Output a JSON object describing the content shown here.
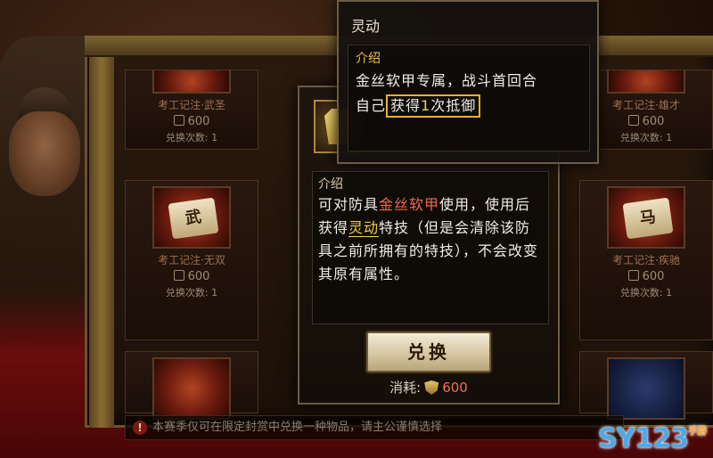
{
  "skill_tooltip": {
    "title": "灵动",
    "section_label": "介绍",
    "line1": "金丝软甲专属，战斗首回合",
    "line2_prefix": "自己",
    "line2_boxed_a": "获得",
    "line2_boxed_num": "1",
    "line2_boxed_b": "次抵御"
  },
  "item_popup": {
    "section_label": "介绍",
    "text_1": "可对防具",
    "armor_name": "金丝软甲",
    "text_2": "使用，使用后获得",
    "skill_name": "灵动",
    "text_3": "特技（但是会清除该防具之前所拥有的特技），不会改变其原有属性。",
    "exchange_button": "兑换",
    "cost_label": "消耗:",
    "cost_amount": "600"
  },
  "shop_cells": [
    {
      "name": "考工记注·武圣",
      "price": "600",
      "times": "兑换次数: 1"
    },
    {
      "name": "考工记注·雄才",
      "price": "600",
      "times": "兑换次数: 1"
    },
    {
      "name": "考工记注·无双",
      "price": "600",
      "times": "兑换次数: 1",
      "glyph": "武"
    },
    {
      "name": "考工记注·疾驰",
      "price": "600",
      "times": "兑换次数: 1",
      "glyph": "马"
    }
  ],
  "notice": "本赛季仅可在限定封赏中兑换一种物品，请主公谨慎选择",
  "watermark": {
    "main": "SY123",
    "sub": "手游"
  }
}
